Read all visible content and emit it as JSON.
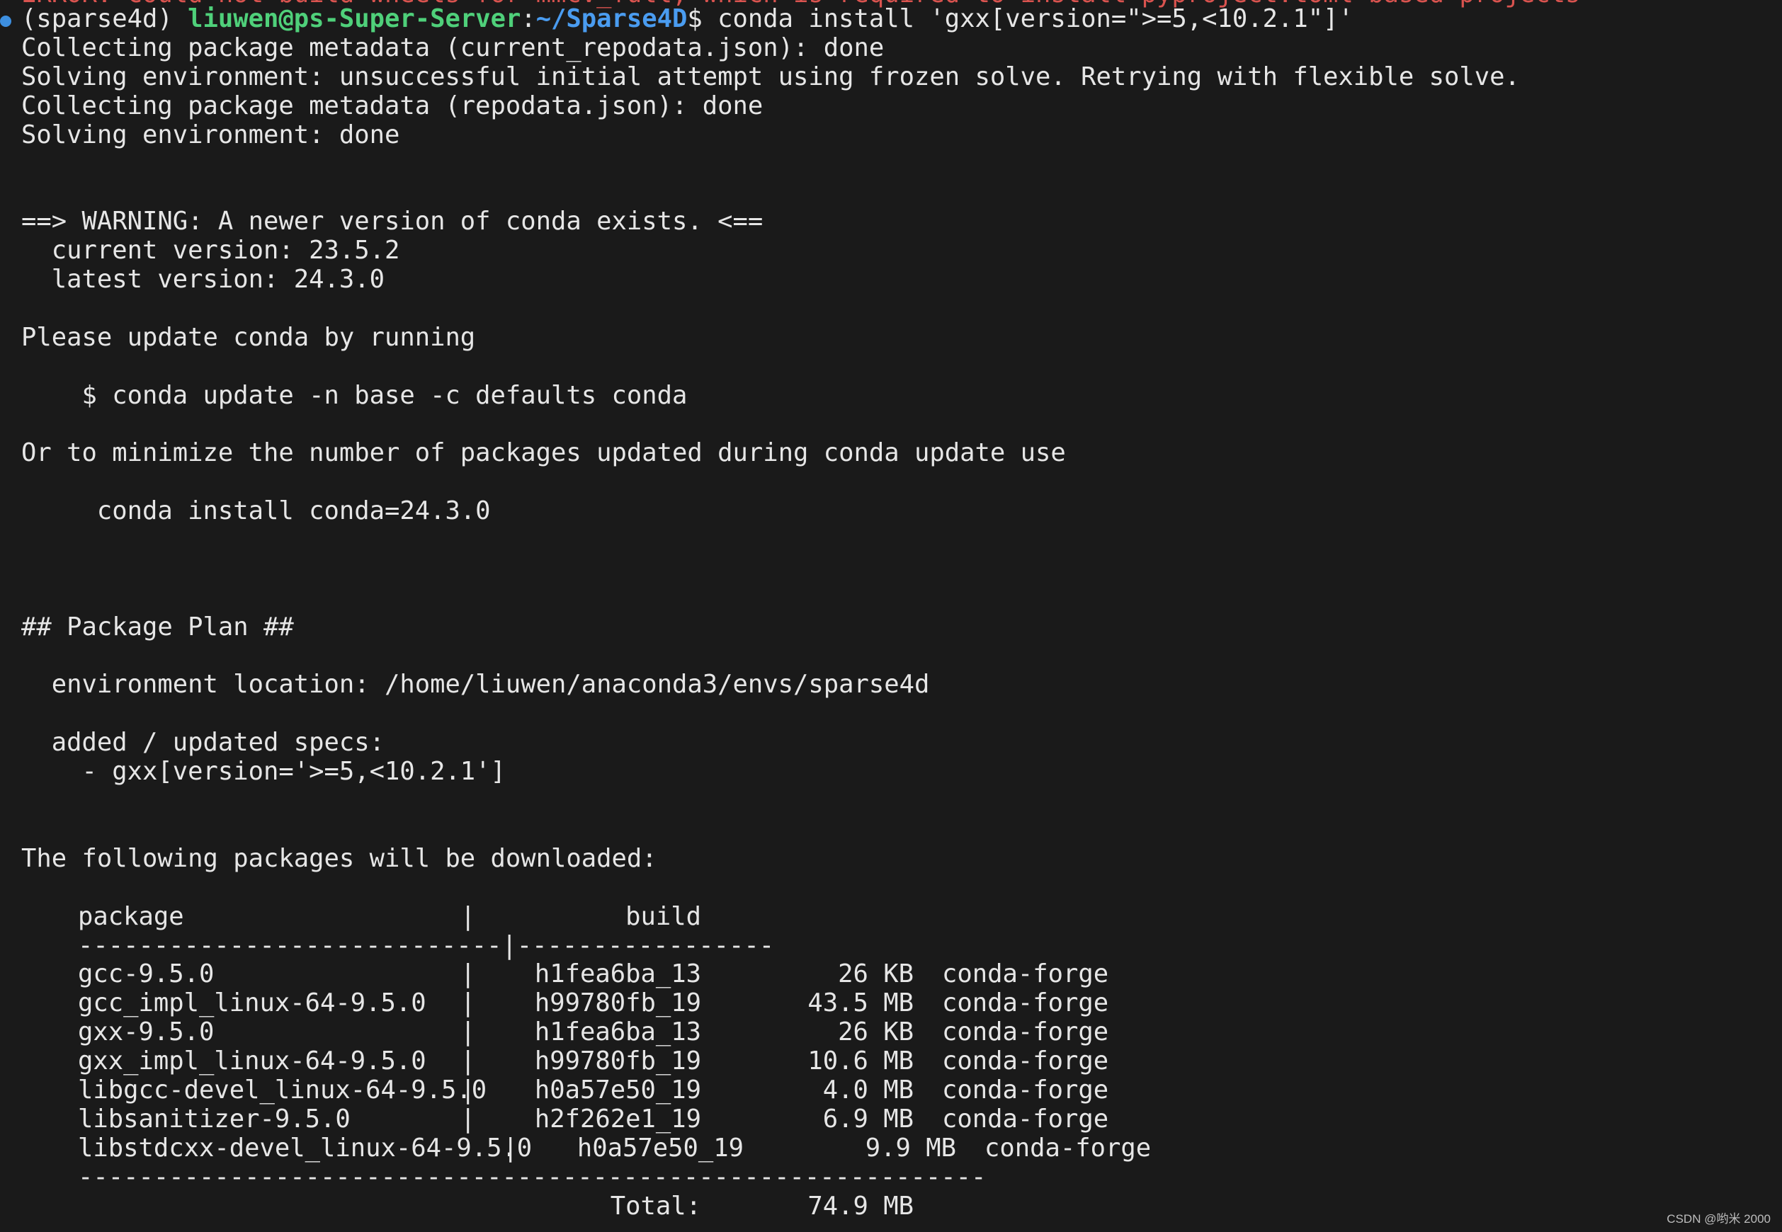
{
  "clipped_top_text": "ERROR: Could not build wheels for mmcv_full, which is required to install pyproject.toml-based projects",
  "prompt": {
    "env": "(sparse4d) ",
    "user_host": "liuwen@ps-Super-Server",
    "colon": ":",
    "path": "~/Sparse4D",
    "dollar": "$ ",
    "command": "conda install 'gxx[version=\">=5,<10.2.1\"]'"
  },
  "lines_before_warning": [
    "Collecting package metadata (current_repodata.json): done",
    "Solving environment: unsuccessful initial attempt using frozen solve. Retrying with flexible solve.",
    "Collecting package metadata (repodata.json): done",
    "Solving environment: done"
  ],
  "warning": {
    "header": "==> WARNING: A newer version of conda exists. <==",
    "current": "  current version: 23.5.2",
    "latest": "  latest version: 24.3.0",
    "please_update": "Please update conda by running",
    "update_cmd": "    $ conda update -n base -c defaults conda",
    "or_minimize": "Or to minimize the number of packages updated during conda update use",
    "install_cmd": "     conda install conda=24.3.0"
  },
  "plan": {
    "header": "## Package Plan ##",
    "env_location": "  environment location: /home/liuwen/anaconda3/envs/sparse4d",
    "specs_label": "  added / updated specs:",
    "spec_item": "    - gxx[version='>=5,<10.2.1']",
    "downloaded_label": "The following packages will be downloaded:"
  },
  "table": {
    "head_package": "package",
    "head_build": "build",
    "separator_line": "----------------------------|-----------------",
    "rows": [
      {
        "package": "gcc-9.5.0",
        "build": "h1fea6ba_13",
        "size": "26 KB",
        "channel": "conda-forge"
      },
      {
        "package": "gcc_impl_linux-64-9.5.0",
        "build": "h99780fb_19",
        "size": "43.5 MB",
        "channel": "conda-forge"
      },
      {
        "package": "gxx-9.5.0",
        "build": "h1fea6ba_13",
        "size": "26 KB",
        "channel": "conda-forge"
      },
      {
        "package": "gxx_impl_linux-64-9.5.0",
        "build": "h99780fb_19",
        "size": "10.6 MB",
        "channel": "conda-forge"
      },
      {
        "package": "libgcc-devel_linux-64-9.5.0",
        "build": "h0a57e50_19",
        "size": "4.0 MB",
        "channel": "conda-forge"
      },
      {
        "package": "libsanitizer-9.5.0",
        "build": "h2f262e1_19",
        "size": "6.9 MB",
        "channel": "conda-forge"
      }
    ],
    "last_row": {
      "package": "libstdcxx-devel_linux-64-9.5.0",
      "build": "h0a57e50_19",
      "size": "9.9 MB",
      "channel": "conda-forge"
    },
    "bottom_rule": "------------------------------------------------------------",
    "total_label": "Total:",
    "total_value": "74.9 MB"
  },
  "watermark": "CSDN @哟米 2000"
}
